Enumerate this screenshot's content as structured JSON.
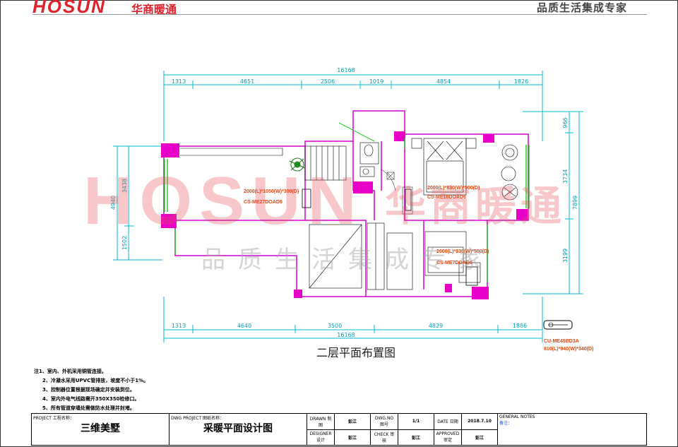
{
  "header": {
    "brand": "HOSUN",
    "brand_cn": "华商暖通",
    "slogan": "品质生活集成专家"
  },
  "watermark": {
    "brand": "HOSUN",
    "brand_cn": "华商暖通",
    "slogan": "品质生活集成专家"
  },
  "dimensions": {
    "top_total": "16168",
    "top_segments": [
      "1313",
      "4651",
      "2506",
      "1019",
      "4854",
      "1826"
    ],
    "bottom_total": "16168",
    "bottom_segments": [
      "1313",
      "4640",
      "3500",
      "4829",
      "1886"
    ],
    "left_outer": "4940",
    "left_inner": [
      "3438",
      "1502"
    ],
    "right_outer": "7899",
    "right_inner": [
      "966",
      "3734",
      "3199"
    ]
  },
  "units": [
    {
      "spec": "2000(L)*1050(W)*300(D)",
      "model": "CS-ME27DOAD6"
    },
    {
      "spec": "2000(L)*830(W)*500(D)",
      "model": "CS-ME18DOAD6"
    },
    {
      "spec": "2000(L)*830(W)*500(D)",
      "model": "CS-ME7DOAD6"
    }
  ],
  "outdoor_unit": {
    "model": "CU-ME45BD3A",
    "spec": "810(L)*940(W)*340(D)"
  },
  "plan_title": "二层平面布置图",
  "notes": [
    "注1、室内、外机采用铜管连接。",
    "2、冷凝水采用UPVC管排放，坡度不小于1%。",
    "3、控制器位置根据现场确定并安装到位。",
    "4、室内外电气线路需开350X350检修口。",
    "5、所有管道穿墙处需做防水处理并封堵。"
  ],
  "title_block": {
    "project_label": "PROJECT 工程名称：",
    "project_value": "三维美墅",
    "drawing_label": "DWG PROJECT 图纸名称：",
    "drawing_value": "采暖平面设计图",
    "drawn_label": "DRAWN 制图",
    "drawn_value": "彭江",
    "designer_label": "DESIGNER 设计",
    "designer_value": "彭江",
    "dwg_no_label": "DWG.NO 图号",
    "dwg_no_value": "1/1",
    "check_label": "CHECK 审核",
    "check_value": "彭江",
    "date_label": "DATE 日期",
    "date_value": "2018.7.10",
    "approved_label": "APPROVED 审定",
    "approved_value": "彭江",
    "general_notes_label": "GENERAL NOTES",
    "general_notes_value": "备注："
  },
  "colors": {
    "wall": "#d400d4",
    "dim": "#00bcd4",
    "furniture": "#000000",
    "unit_text": "#e8440a",
    "window": "#22cc22"
  }
}
